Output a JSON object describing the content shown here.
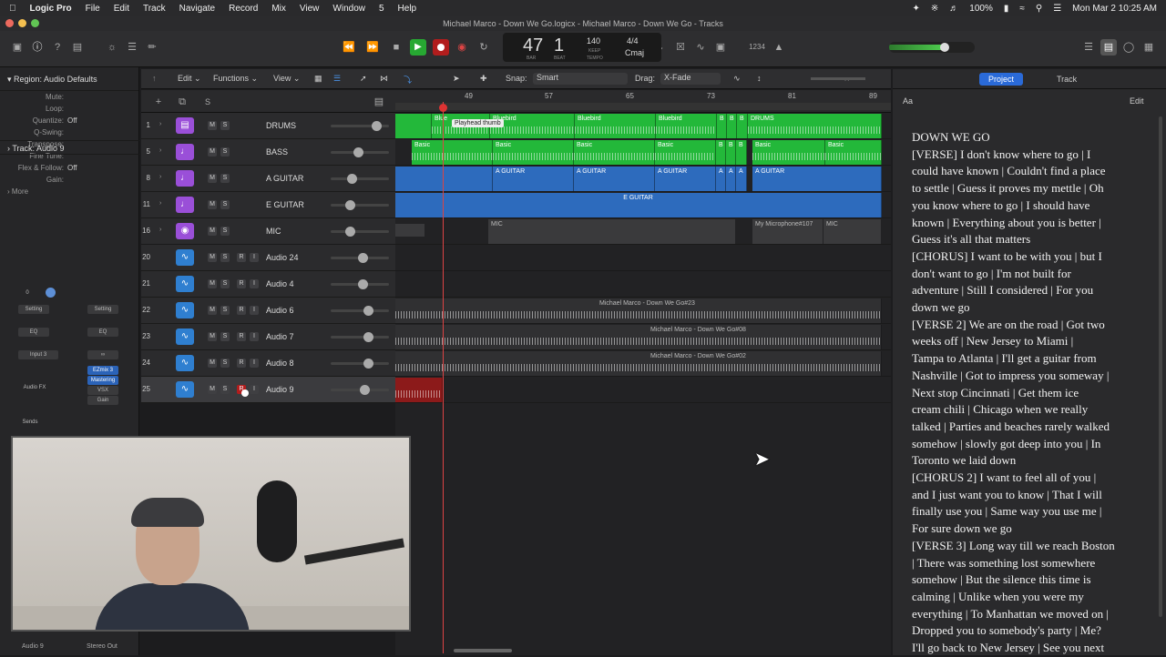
{
  "menubar": {
    "apple": "",
    "app": "Logic Pro",
    "items": [
      "File",
      "Edit",
      "Track",
      "Navigate",
      "Record",
      "Mix",
      "View",
      "Window",
      "5",
      "Help"
    ],
    "battery": "100%",
    "datetime": "Mon Mar 2  10:25 AM"
  },
  "window": {
    "title": "Michael Marco - Down We Go.logicx - Michael Marco - Down We Go - Tracks"
  },
  "lcd": {
    "bar": "47",
    "beat": "1",
    "bar_label": "BAR",
    "beat_label": "BEAT",
    "tempo": "140",
    "tempo_mode": "KEEP",
    "tempo_label": "TEMPO",
    "signature": "4/4",
    "key": "Cmaj"
  },
  "toolbar": {
    "count_in": "1234"
  },
  "inspector": {
    "region_header": "Region: Audio Defaults",
    "rows": [
      {
        "k": "Mute:",
        "v": ""
      },
      {
        "k": "Loop:",
        "v": ""
      },
      {
        "k": "Quantize:",
        "v": "Off"
      },
      {
        "k": "Q-Swing:",
        "v": ""
      },
      {
        "k": "Transpose:",
        "v": ""
      },
      {
        "k": "Fine Tune:",
        "v": ""
      },
      {
        "k": "Flex & Follow:",
        "v": "Off"
      },
      {
        "k": "Gain:",
        "v": ""
      }
    ],
    "more": "More",
    "track_header": "Track:  Audio 9",
    "strip": {
      "value": "0",
      "setting": "Setting",
      "eq": "EQ",
      "input": "Input 3",
      "audio_fx": "Audio FX",
      "plugins": [
        "EZmix 3",
        "Mastering",
        "VSX",
        "Gain"
      ],
      "sends": "Sends",
      "stereo_out": "Stereo Out"
    },
    "footer": {
      "left": "Audio 9",
      "right": "Stereo Out"
    }
  },
  "tracks_header": {
    "edit": "Edit",
    "functions": "Functions",
    "view": "View",
    "snap_label": "Snap:",
    "snap_value": "Smart",
    "drag_label": "Drag:",
    "drag_value": "X-Fade",
    "s_button": "S"
  },
  "ruler": {
    "bars": [
      "49",
      "57",
      "65",
      "73",
      "81",
      "89"
    ]
  },
  "playhead_tooltip": "Playhead thumb",
  "tracks": [
    {
      "num": "1",
      "name": "DRUMS",
      "color": "#9a4fd8",
      "icon": "drum-icon",
      "rec": false,
      "has_rec": false
    },
    {
      "num": "5",
      "name": "BASS",
      "color": "#9a4fd8",
      "icon": "guitar-icon",
      "rec": false,
      "has_rec": false
    },
    {
      "num": "8",
      "name": "A GUITAR",
      "color": "#9a4fd8",
      "icon": "guitar-icon",
      "rec": false,
      "has_rec": false
    },
    {
      "num": "11",
      "name": "E GUITAR",
      "color": "#9a4fd8",
      "icon": "guitar-icon",
      "rec": false,
      "has_rec": false
    },
    {
      "num": "16",
      "name": "MIC",
      "color": "#9a4fd8",
      "icon": "mic-icon",
      "rec": false,
      "has_rec": false
    },
    {
      "num": "20",
      "name": "Audio 24",
      "color": "#2f7fd0",
      "icon": "waveform-icon",
      "rec": false,
      "has_rec": true
    },
    {
      "num": "21",
      "name": "Audio 4",
      "color": "#2f7fd0",
      "icon": "waveform-icon",
      "rec": false,
      "has_rec": true
    },
    {
      "num": "22",
      "name": "Audio 6",
      "color": "#2f7fd0",
      "icon": "waveform-icon",
      "rec": false,
      "has_rec": true
    },
    {
      "num": "23",
      "name": "Audio 7",
      "color": "#2f7fd0",
      "icon": "waveform-icon",
      "rec": false,
      "has_rec": true
    },
    {
      "num": "24",
      "name": "Audio 8",
      "color": "#2f7fd0",
      "icon": "waveform-icon",
      "rec": false,
      "has_rec": true
    },
    {
      "num": "25",
      "name": "Audio 9",
      "color": "#2f7fd0",
      "icon": "waveform-icon",
      "rec": true,
      "has_rec": true
    }
  ],
  "regions": {
    "drums": [
      {
        "label": "Blue",
        "w": 0
      },
      {
        "label": "Bluebird",
        "w": 0
      },
      {
        "label": "Bluebird",
        "w": 0
      },
      {
        "label": "Bluebird",
        "w": 0
      },
      {
        "label": "B",
        "w": 0
      },
      {
        "label": "B",
        "w": 0
      },
      {
        "label": "B",
        "w": 0
      },
      {
        "label": "DRUMS",
        "w": 0
      }
    ],
    "bass": [
      "Basic",
      "Basic",
      "Basic",
      "Basic",
      "B",
      "B",
      "B",
      "Basic",
      "Basic"
    ],
    "aguitar": [
      "A GUITAR",
      "A GUITAR",
      "A GUITAR",
      "A",
      "A",
      "A",
      "A GUITAR"
    ],
    "eguitar": "E GUITAR",
    "mic": [
      "MIC",
      "My Microphone#107",
      "MIC"
    ],
    "audio6": "Michael Marco - Down We Go#23",
    "audio7": "Michael Marco - Down We Go#08",
    "audio8": "Michael Marco - Down We Go#02"
  },
  "right_pane": {
    "tabs": [
      "Project",
      "Track"
    ],
    "aa": "Aa",
    "edit": "Edit",
    "lyrics": [
      "DOWN WE GO",
      "[VERSE]  I don't know where to go  |  I",
      "could have known  |  Couldn't find a place",
      "to settle  |  Guess it proves my mettle  |  Oh",
      "you know where to go  |  I should have",
      "known  |  Everything about you is better  |",
      "Guess it's all that matters",
      "[CHORUS]  I want to be with you  |  but I",
      "don't want to go  |  I'm not built for",
      "adventure  |  Still I considered  |  For you",
      "down we go",
      "[VERSE 2]  We are on the road  |  Got two",
      "weeks off  |  New Jersey to Miami  |",
      "Tampa to Atlanta  |  I'll get a guitar from",
      "Nashville  |  Got to impress you someway  |",
      "  Next stop Cincinnati  |  Get them ice",
      "cream chili  |  Chicago when we really",
      "talked  |  Parties and beaches rarely walked",
      "somehow  |  slowly got deep into you  |  In",
      "Toronto we laid down",
      "[CHORUS 2]  I want to feel all of you  |",
      "and I just want you to know  |  That I will",
      "finally use you  |  Same way you use me |",
      "For sure down we go",
      "[VERSE 3]  Long way till we reach Boston",
      "|  There was something lost somewhere",
      "somehow  |  But the silence this time is",
      "calming  |  Unlike when you were my",
      "everything  |  To Manhattan we moved on  |",
      "  Dropped you to somebody's party  |  Me?",
      "I'll go back to New Jersey  |  See you next"
    ]
  }
}
